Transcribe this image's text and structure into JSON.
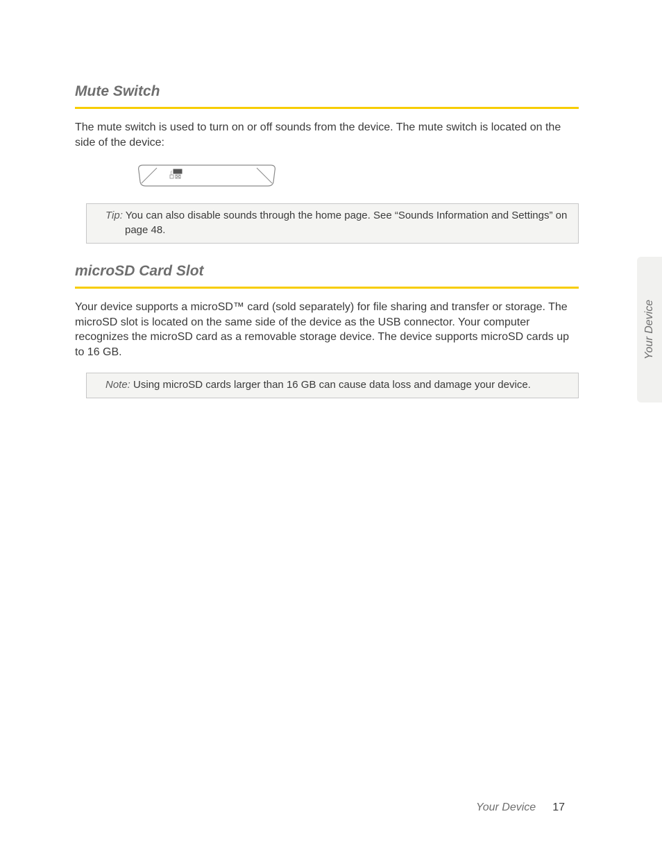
{
  "sideTab": "Your Device",
  "footer": {
    "section": "Your Device",
    "page": "17"
  },
  "sections": {
    "mute": {
      "heading": "Mute Switch",
      "body": "The mute switch is used to turn on or off sounds from the device. The mute switch is located on the side of the device:",
      "tipLabel": "Tip:",
      "tipText": " You can also disable sounds through the home page. See “Sounds Information and Settings” on page 48."
    },
    "microsd": {
      "heading": "microSD Card Slot",
      "body": "Your device supports a microSD™ card (sold separately) for file sharing and transfer or storage. The microSD slot is located on the same side of the device as the USB connector. Your computer recognizes the microSD card as a removable storage device. The device supports microSD cards up to 16 GB.",
      "noteLabel": "Note:",
      "noteText": "  Using microSD cards larger than 16 GB can cause data loss and damage your device."
    }
  }
}
